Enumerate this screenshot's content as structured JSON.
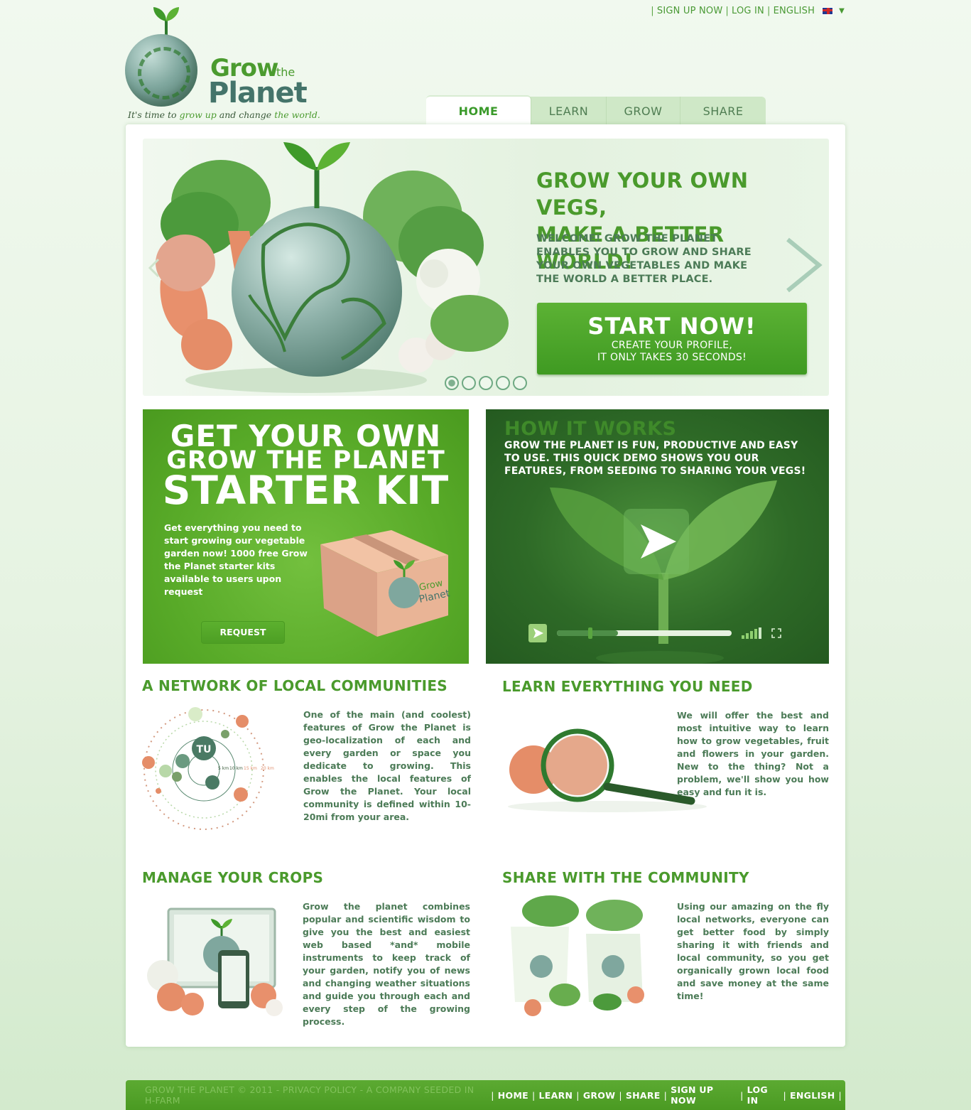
{
  "topbar": {
    "signup": "SIGN UP NOW",
    "login": "LOG IN",
    "language": "ENGLISH",
    "separator": "|"
  },
  "logo": {
    "grow": "Grow",
    "the": "the",
    "planet": "Planet",
    "tagline_parts": [
      "It's time to ",
      "grow up",
      " and change ",
      "the world."
    ]
  },
  "nav": {
    "tabs": [
      {
        "label": "HOME",
        "active": true
      },
      {
        "label": "LEARN",
        "active": false
      },
      {
        "label": "GROW",
        "active": false
      },
      {
        "label": "SHARE",
        "active": false
      }
    ]
  },
  "hero": {
    "title_line1": "GROW YOUR OWN VEGS,",
    "title_line2": "MAKE A BETTER WORLD!",
    "text": "WELCOME! GROW THE PLANET ENABLES YOU TO GROW AND SHARE YOUR OWN VEGETABLES AND MAKE THE WORLD A BETTER PLACE.",
    "cta_big": "START NOW!",
    "cta_small_1": "CREATE YOUR PROFILE,",
    "cta_small_2": "IT ONLY TAKES 30 SECONDS!",
    "slide_count": 5,
    "active_slide": 1
  },
  "kit": {
    "line1": "GET YOUR OWN",
    "line2": "GROW THE PLANET",
    "line3": "STARTER KIT",
    "text": "Get everything you need to start growing our vegetable garden now! 1000 free Grow the Planet starter kits available to users upon request",
    "button": "REQUEST",
    "box_label_1": "Grow",
    "box_label_2": "Planet"
  },
  "how": {
    "title": "HOW IT WORKS",
    "text": "GROW THE PLANET IS FUN, PRODUCTIVE AND EASY  TO USE. THIS QUICK DEMO SHOWS YOU OUR FEATURES, FROM SEEDING TO SHARING YOUR VEGS!",
    "progress": 0.35,
    "buffer": 0.18
  },
  "features": {
    "network": {
      "title": "A NETWORK OF LOCAL COMMUNITIES",
      "text": "One of the main (and coolest) features of Grow the Planet is geo-localization of each and every garden or space you dedicate to growing. This enables the local features of Grow the Planet. Your local community is defined within 10-20mi from your area.",
      "center_label": "TU",
      "rings": [
        "5 km",
        "10 km",
        "15 km",
        "20 km"
      ]
    },
    "learn": {
      "title": "LEARN EVERYTHING YOU NEED",
      "text": "We will offer the best and most intuitive way to learn how to grow vegetables, fruit and flowers in your garden. New to the thing? Not a problem, we'll show you how easy and fun it is."
    },
    "manage": {
      "title": "MANAGE YOUR CROPS",
      "text": "Grow the planet combines popular and scientific wisdom to give you the best and easiest web based *and* mobile instruments to keep track of your garden, notify you of news and changing weather situations and guide you through each and every step of the growing process."
    },
    "share": {
      "title": "SHARE WITH THE COMMUNITY",
      "text": "Using our amazing on the fly local networks, everyone can get better food by simply sharing it with friends and local community, so you get organically grown local food and save money at the same time!"
    }
  },
  "footer": {
    "copyright": "GROW THE PLANET © 2011 - PRIVACY POLICY - A COMPANY SEEDED IN H-FARM",
    "links": [
      "HOME",
      "LEARN",
      "GROW",
      "SHARE",
      "SIGN UP NOW",
      "LOG IN",
      "ENGLISH"
    ]
  },
  "colors": {
    "brand_green": "#4a9a2c",
    "dark_green": "#2e6a27",
    "text_green": "#4c7b57"
  }
}
